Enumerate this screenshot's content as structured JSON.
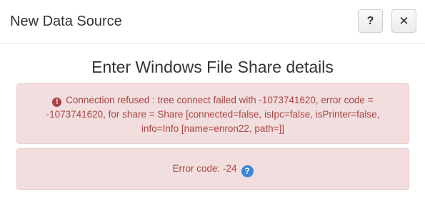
{
  "dialog": {
    "title": "New Data Source",
    "help_label": "?",
    "close_label": "✕"
  },
  "body": {
    "section_title": "Enter Windows File Share details",
    "error_alert": {
      "icon": "exclamation-circle-icon",
      "message_line1": "Connection refused : tree connect failed with -1073741620, error code =",
      "message_line2": "-1073741620, for share = Share [connected=false, isIpc=false, isPrinter=false,",
      "message_line3": "info=Info [name=enron22, path=]]"
    },
    "code_alert": {
      "text": "Error code: -24",
      "icon": "question-circle-icon"
    }
  },
  "colors": {
    "alert_background": "#f2dede",
    "alert_text": "#a94442",
    "help_icon": "#3a87d8"
  }
}
